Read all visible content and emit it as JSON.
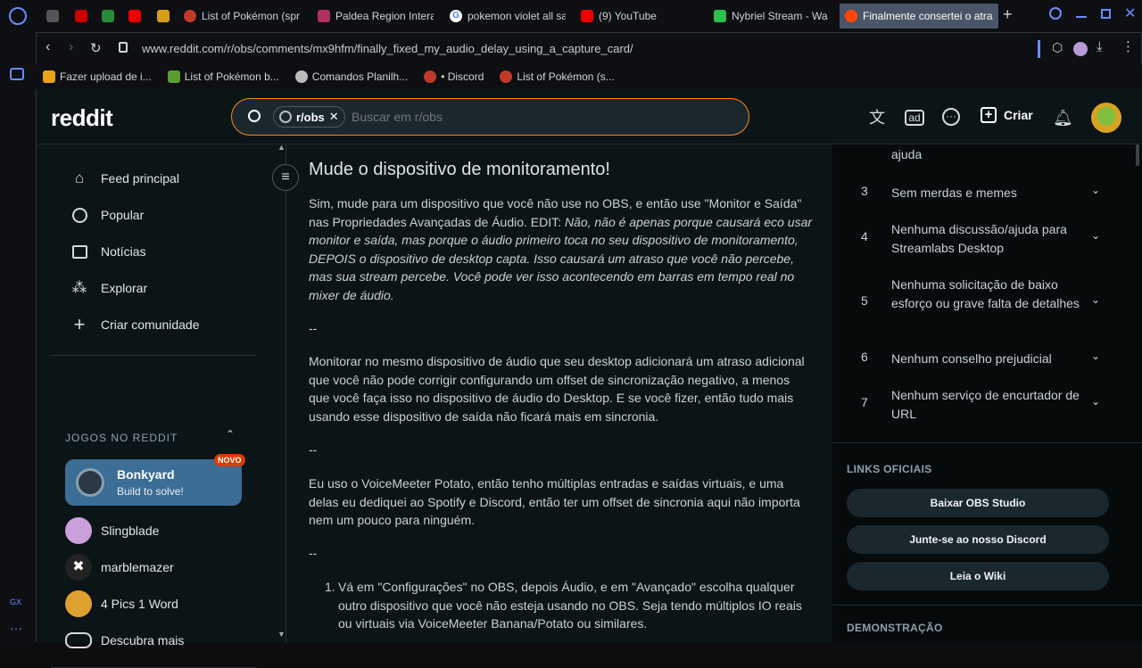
{
  "browser": {
    "tabs": [
      {
        "label": "",
        "fav_color": "#555"
      },
      {
        "label": "",
        "fav_color": "#c00"
      },
      {
        "label": "",
        "fav_color": "#2a8a3a"
      },
      {
        "label": "",
        "fav_color": "#e00"
      },
      {
        "label": "",
        "fav_color": "#d4a017"
      },
      {
        "label": "List of Pokémon (spr",
        "fav_color": "#c0392b"
      },
      {
        "label": "Paldea Region Intera",
        "fav_color": "#b03060"
      },
      {
        "label": "pokemon violet all sa",
        "fav_color": "#4285f4"
      },
      {
        "label": "(9) YouTube",
        "fav_color": "#e00"
      },
      {
        "label": "Nybriel Stream - Wa",
        "fav_color": "#2fbf4a"
      },
      {
        "label": "Finalmente consertei o atra",
        "fav_color": "#ff4500"
      }
    ],
    "url": "www.reddit.com/r/obs/comments/mx9hfm/finally_fixed_my_audio_delay_using_a_capture_card/",
    "bookmarks": [
      {
        "label": "Fazer upload de i...",
        "fav_color": "#e8a317"
      },
      {
        "label": "List of Pokémon b...",
        "fav_color": "#5a9e2f"
      },
      {
        "label": "Comandos Planilh...",
        "fav_color": "#bbbbbb"
      },
      {
        "label": "• Discord",
        "fav_color": "#c0392b"
      },
      {
        "label": "List of Pokémon (s...",
        "fav_color": "#c0392b"
      }
    ],
    "gx_label": "GX"
  },
  "reddit": {
    "logo": "reddit",
    "search": {
      "chip": "r/obs",
      "placeholder": "Buscar em r/obs"
    },
    "create_label": "Criar",
    "nav": [
      {
        "label": "Feed principal",
        "icon": "home-icon"
      },
      {
        "label": "Popular",
        "icon": "popular-icon"
      },
      {
        "label": "Notícias",
        "icon": "news-icon"
      },
      {
        "label": "Explorar",
        "icon": "explore-icon"
      },
      {
        "label": "Criar comunidade",
        "icon": "plus-icon"
      }
    ],
    "games_heading": "JOGOS NO REDDIT",
    "featured_game": {
      "title": "Bonkyard",
      "subtitle": "Build to solve!",
      "badge": "NOVO"
    },
    "games": [
      {
        "label": "Slingblade",
        "color": "#c9a0dc"
      },
      {
        "label": "marblemazer",
        "color": "#222"
      },
      {
        "label": "4 Pics 1 Word",
        "color": "#e0a030"
      },
      {
        "label": "Descubra mais",
        "color": ""
      }
    ]
  },
  "post": {
    "heading": "Mude o dispositivo de monitoramento!",
    "p1_plain": "Sim, mude para um dispositivo que você não use no OBS, e então use \"Monitor e Saída\" nas Propriedades Avançadas de Áudio. EDIT: ",
    "p1_italic": "Não, não é apenas porque causará eco usar monitor e saída, mas porque o áudio primeiro toca no seu dispositivo de monitoramento, DEPOIS o dispositivo de desktop capta. Isso causará um atraso que você não percebe, mas sua stream percebe. Você pode ver isso acontecendo em barras em tempo real no mixer de áudio.",
    "dash": "--",
    "p2": "Monitorar no mesmo dispositivo de áudio que seu desktop adicionará um atraso adicional que você não pode corrigir configurando um offset de sincronização negativo, a menos que você faça isso no dispositivo de áudio do Desktop. E se você fizer, então tudo mais usando esse dispositivo de saída não ficará mais em sincronia.",
    "p3": "Eu uso o VoiceMeeter Potato, então tenho múltiplas entradas e saídas virtuais, e uma delas eu dediquei ao Spotify e Discord, então ter um offset de sincronia aqui não importa nem um pouco para ninguém.",
    "list1_num": "1.",
    "list1": "Vá em \"Configurações\" no OBS, depois Áudio, e em \"Avançado\" escolha qualquer outro dispositivo que você não esteja usando no OBS. Seja tendo múltiplos IO reais ou virtuais via VoiceMeeter Banana/Potato ou similares."
  },
  "rules": {
    "top_fragment": "ajuda",
    "items": [
      {
        "num": "3",
        "label": "Sem merdas e memes"
      },
      {
        "num": "4",
        "label": "Nenhuma discussão/ajuda para Streamlabs Desktop"
      },
      {
        "num": "5",
        "label": "Nenhuma solicitação de baixo esforço ou grave falta de detalhes"
      },
      {
        "num": "6",
        "label": "Nenhum conselho prejudicial"
      },
      {
        "num": "7",
        "label": "Nenhum serviço de encurtador de URL"
      }
    ]
  },
  "links": {
    "heading": "LINKS OFICIAIS",
    "buttons": [
      "Baixar OBS Studio",
      "Junte-se ao nosso Discord",
      "Leia o Wiki"
    ]
  },
  "demo_heading": "DEMONSTRAÇÃO"
}
